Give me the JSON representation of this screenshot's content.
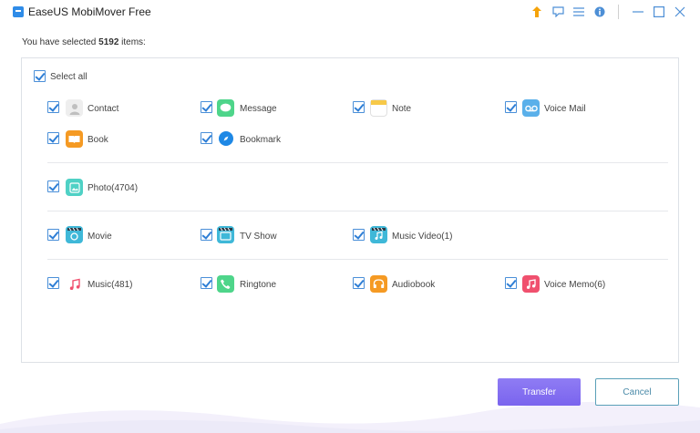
{
  "window": {
    "title": "EaseUS MobiMover Free"
  },
  "summary": {
    "prefix": "You have selected ",
    "count": "5192",
    "suffix": " items:"
  },
  "select_all": {
    "label": "Select all",
    "checked": true
  },
  "items": {
    "contact": {
      "label": "Contact",
      "checked": true
    },
    "message": {
      "label": "Message",
      "checked": true
    },
    "note": {
      "label": "Note",
      "checked": true
    },
    "voice_mail": {
      "label": "Voice Mail",
      "checked": true
    },
    "book": {
      "label": "Book",
      "checked": true
    },
    "bookmark": {
      "label": "Bookmark",
      "checked": true
    },
    "photo": {
      "label": "Photo(4704)",
      "checked": true
    },
    "movie": {
      "label": "Movie",
      "checked": true
    },
    "tv_show": {
      "label": "TV Show",
      "checked": true
    },
    "music_video": {
      "label": "Music Video(1)",
      "checked": true
    },
    "music": {
      "label": "Music(481)",
      "checked": true
    },
    "ringtone": {
      "label": "Ringtone",
      "checked": true
    },
    "audiobook": {
      "label": "Audiobook",
      "checked": true
    },
    "voice_memo": {
      "label": "Voice Memo(6)",
      "checked": true
    }
  },
  "buttons": {
    "transfer": "Transfer",
    "cancel": "Cancel"
  },
  "colors": {
    "accent": "#2f8ce8",
    "transfer_button": "#8a76f2",
    "cancel_border": "#5aa0b8"
  }
}
